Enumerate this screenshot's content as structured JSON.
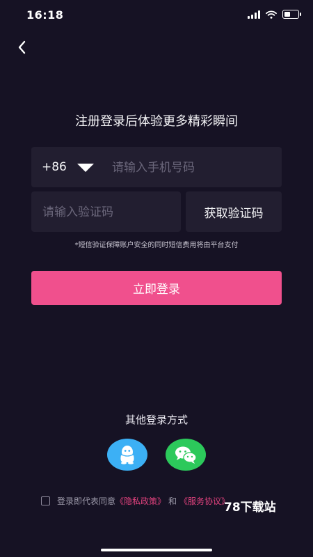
{
  "status": {
    "time": "16:18"
  },
  "nav": {
    "back_icon": "chevron-left-icon"
  },
  "title": "注册登录后体验更多精彩瞬间",
  "phone": {
    "country_code": "+86",
    "dropdown_icon": "caret-down-icon",
    "placeholder": "请输入手机号码",
    "value": ""
  },
  "code": {
    "placeholder": "请输入验证码",
    "value": "",
    "get_code_label": "获取验证码"
  },
  "notice": "*短信验证保障账户安全的同时短信费用将由平台支付",
  "login_label": "立即登录",
  "other": {
    "title": "其他登录方式",
    "qq_icon": "qq-icon",
    "wechat_icon": "wechat-icon"
  },
  "agreement": {
    "prefix": "登录即代表同意",
    "privacy_link": "《隐私政策》",
    "and": "和",
    "service_link": "《服务协议》",
    "checked": false
  },
  "watermark": "78下载站",
  "colors": {
    "background": "#161224",
    "input_bg": "#221e30",
    "accent": "#f0508d",
    "link": "#e2427e",
    "qq": "#3cb0f5",
    "wechat": "#2cc95b"
  }
}
